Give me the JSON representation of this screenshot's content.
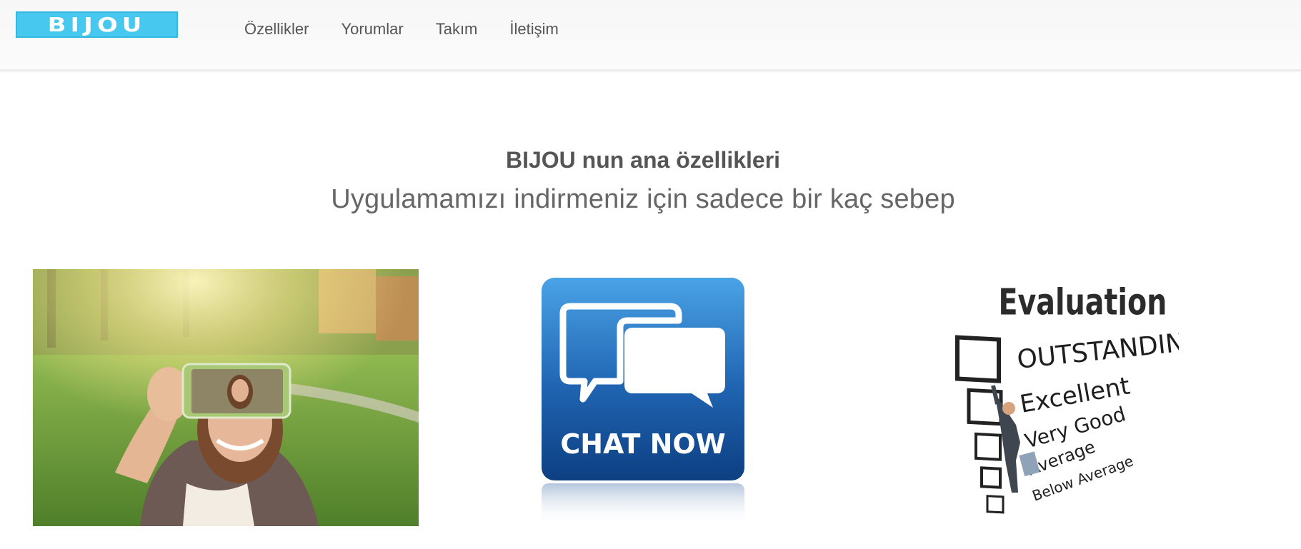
{
  "brand": {
    "logo_text": "BIJOU",
    "color": "#47c9ef"
  },
  "nav": {
    "items": [
      {
        "label": "Özellikler"
      },
      {
        "label": "Yorumlar"
      },
      {
        "label": "Takım"
      },
      {
        "label": "İletişim"
      }
    ]
  },
  "features": {
    "title": "BIJOU nun ana özellikleri",
    "subtitle": "Uygulamamızı indirmeniz için sadece bir kaç sebep",
    "images": [
      {
        "name": "selfie-photo"
      },
      {
        "name": "chat-now-image",
        "text": "CHAT NOW"
      },
      {
        "name": "evaluation-image",
        "title": "Evaluation",
        "options": [
          "OUTSTANDING",
          "Excellent",
          "Very Good",
          "Average",
          "Below Average"
        ]
      }
    ]
  }
}
